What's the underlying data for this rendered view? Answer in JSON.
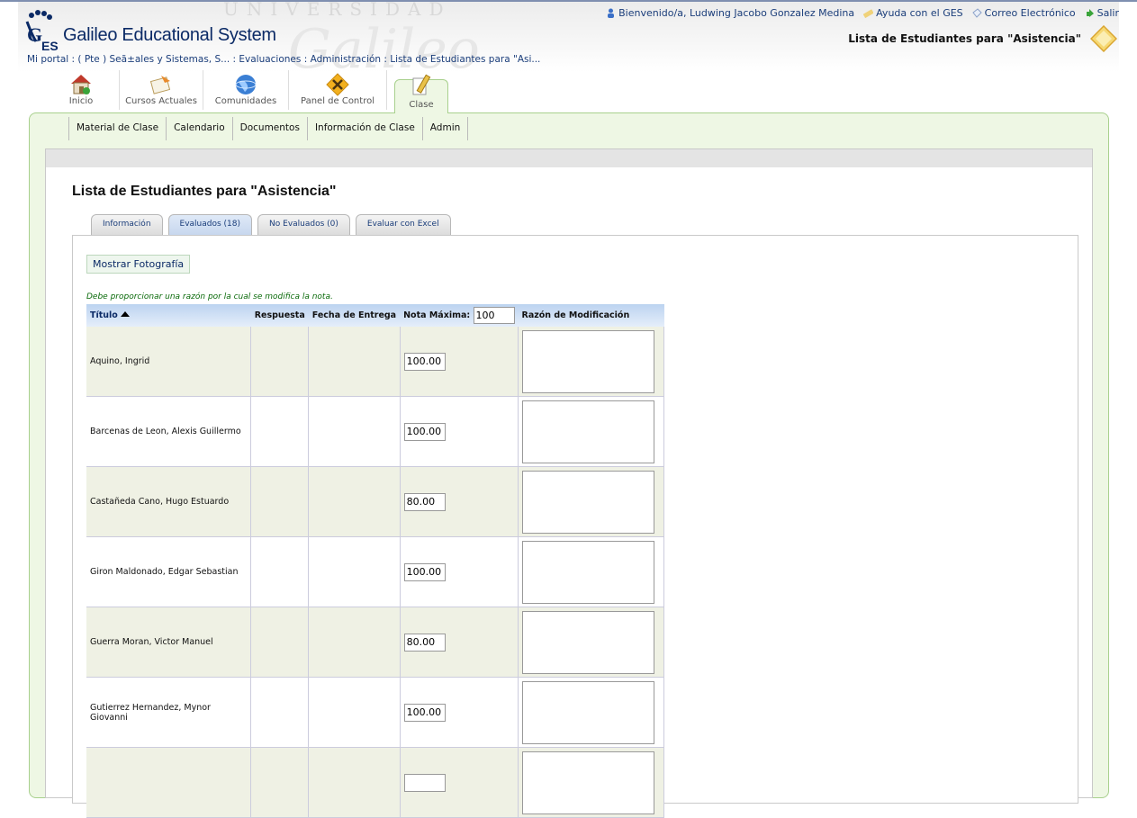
{
  "header": {
    "watermark_top": "UNIVERSIDAD",
    "watermark_big": "Galileo",
    "brand": "Galileo Educational System",
    "welcome": "Bienvenido/a, Ludwing Jacobo Gonzalez Medina",
    "help": "Ayuda con el GES",
    "mail": "Correo Electrónico",
    "logout": "Salir",
    "page_title": "Lista de Estudiantes para \"Asistencia\""
  },
  "breadcrumb": {
    "text": "Mi portal : ( Pte ) Seã±ales y Sistemas, S... : Evaluaciones : Administración : Lista de Estudiantes para \"Asi..."
  },
  "main_tabs": [
    {
      "label": "Inicio",
      "icon": "house-icon"
    },
    {
      "label": "Cursos Actuales",
      "icon": "courses-icon"
    },
    {
      "label": "Comunidades",
      "icon": "globe-icon"
    },
    {
      "label": "Panel de Control",
      "icon": "tools-icon"
    },
    {
      "label": "Clase",
      "icon": "pencil-icon"
    }
  ],
  "sub_nav": [
    "Material de Clase",
    "Calendario",
    "Documentos",
    "Información de Clase",
    "Admin"
  ],
  "content": {
    "title": "Lista de Estudiantes para \"Asistencia\"",
    "tabs": [
      "Información",
      "Evaluados (18)",
      "No Evaluados (0)",
      "Evaluar con Excel"
    ],
    "photo_button": "Mostrar Fotografía",
    "note": "Debe proporcionar una razón por la cual se modifica la nota.",
    "columns": {
      "title": "Título",
      "response": "Respuesta",
      "delivery": "Fecha de Entrega",
      "max_grade": "Nota Máxima:",
      "reason": "Razón de Modificación"
    },
    "max_grade_value": "100",
    "students": [
      {
        "name": "Aquino, Ingrid",
        "grade": "100.00"
      },
      {
        "name": "Barcenas de Leon, Alexis Guillermo",
        "grade": "100.00"
      },
      {
        "name": "Castañeda Cano, Hugo Estuardo",
        "grade": "80.00"
      },
      {
        "name": "Giron Maldonado, Edgar Sebastian",
        "grade": "100.00"
      },
      {
        "name": "Guerra Moran, Victor Manuel",
        "grade": "80.00"
      },
      {
        "name": "Gutierrez Hernandez, Mynor Giovanni",
        "grade": "100.00"
      },
      {
        "name": "",
        "grade": ""
      }
    ]
  },
  "colors": {
    "accent_green": "#a8d08d",
    "link_blue": "#1a3d7a",
    "header_blue": "#bcd3f0"
  }
}
